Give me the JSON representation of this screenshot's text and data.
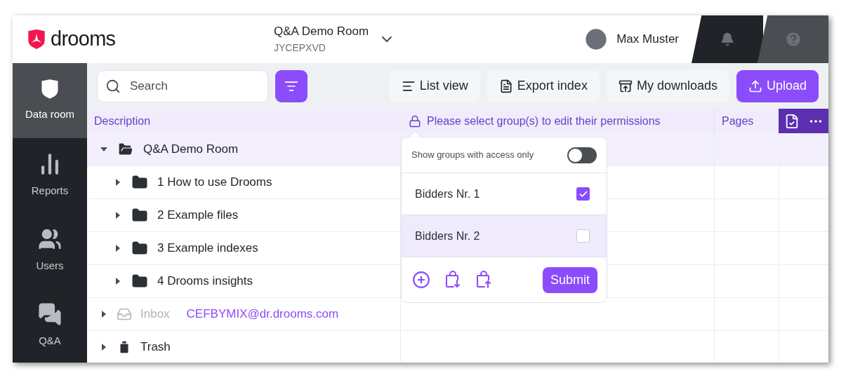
{
  "header": {
    "logo": "drooms",
    "room": {
      "name": "Q&A Demo Room",
      "code": "JYCEPXVD"
    },
    "user": {
      "name": "Max Muster"
    }
  },
  "sidebar": {
    "items": [
      {
        "label": "Data room",
        "kind": "dataroom",
        "selected": true
      },
      {
        "label": "Reports",
        "kind": "reports",
        "selected": false
      },
      {
        "label": "Users",
        "kind": "users",
        "selected": false
      },
      {
        "label": "Q&A",
        "kind": "qa",
        "selected": false
      }
    ]
  },
  "toolbar": {
    "search": {
      "placeholder": "Search"
    },
    "buttons": [
      {
        "label": "List view",
        "kind": "list"
      },
      {
        "label": "Export index",
        "kind": "export"
      },
      {
        "label": "My downloads",
        "kind": "downloads"
      },
      {
        "label": "Upload",
        "kind": "upload"
      }
    ]
  },
  "table": {
    "columns": [
      {
        "label": "Description"
      },
      {
        "label": "Please select group(s) to edit their permissions"
      },
      {
        "label": "Pages"
      }
    ],
    "rows": [
      {
        "label": "Q&A Demo Room",
        "kind": "folder",
        "expanded": true,
        "selected": true,
        "disabled": false,
        "children": [
          {
            "label": "1 How to use Drooms",
            "kind": "folder",
            "expanded": false,
            "selected": false,
            "disabled": false
          },
          {
            "label": "2 Example files",
            "kind": "folder",
            "expanded": false,
            "selected": false,
            "disabled": false
          },
          {
            "label": "3 Example indexes",
            "kind": "folder",
            "expanded": false,
            "selected": false,
            "disabled": false
          },
          {
            "label": "4 Drooms insights",
            "kind": "folder",
            "expanded": false,
            "selected": false,
            "disabled": false
          }
        ]
      },
      {
        "label": "Inbox",
        "kind": "inbox",
        "expanded": false,
        "selected": false,
        "disabled": true,
        "email": "CEFBYMIX@dr.drooms.com"
      },
      {
        "label": "Trash",
        "kind": "trash",
        "expanded": false,
        "selected": false,
        "disabled": false
      }
    ]
  },
  "permissions_popover": {
    "toggle": {
      "label": "Show groups with access only",
      "on": false
    },
    "groups": [
      {
        "name": "Bidders Nr. 1",
        "checked": true,
        "selected": false
      },
      {
        "name": "Bidders Nr. 2",
        "checked": false,
        "selected": true
      }
    ],
    "submit": "Submit"
  }
}
